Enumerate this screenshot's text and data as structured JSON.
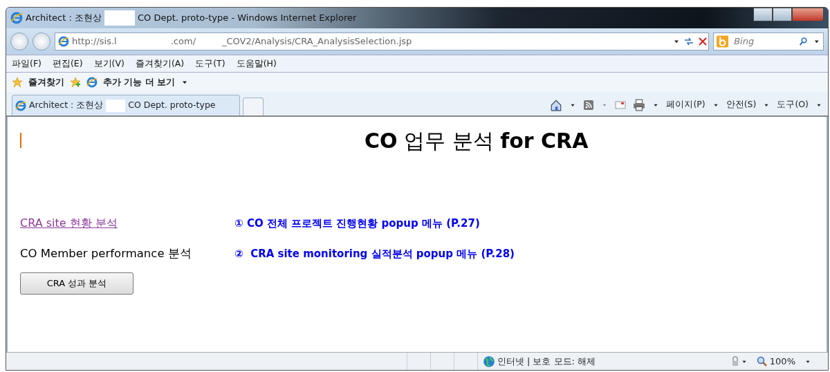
{
  "window": {
    "title_parts": [
      "Architect : 조현상",
      "CO Dept. proto-type - Windows Internet Explorer"
    ]
  },
  "address_bar": {
    "url_parts": [
      "http://sis.l",
      ".com/",
      "_COV2/Analysis/CRA_AnalysisSelection.jsp"
    ]
  },
  "search": {
    "placeholder": "Bing"
  },
  "menu": [
    "파일(F)",
    "편집(E)",
    "보기(V)",
    "즐겨찾기(A)",
    "도구(T)",
    "도움말(H)"
  ],
  "favorites_bar": {
    "favorites": "즐겨찾기",
    "addons": "추가 기능 더 보기"
  },
  "tabs": [
    {
      "title_parts": [
        "Architect : 조현상",
        "CO Dept. proto-type"
      ],
      "selected": true
    }
  ],
  "command_bar": [
    "페이지(P)",
    "안전(S)",
    "도구(O)"
  ],
  "page": {
    "heading": "**CO** 업무 분석 **for CRA**",
    "links": [
      {
        "kind": "link",
        "label": "CRA site 현황 분석",
        "note": "① CO 전체 프로젝트 진행현황 popup 메뉴 (P.27)"
      },
      {
        "kind": "text",
        "label": "CO Member performance 분석",
        "note": "②  CRA site monitoring 실적분석 popup 메뉴 (P.28)"
      }
    ],
    "button": "CRA 성과 분석"
  },
  "status_bar": {
    "zone": "인터넷 | 보호 모드: 해제",
    "zoom": "100%"
  }
}
